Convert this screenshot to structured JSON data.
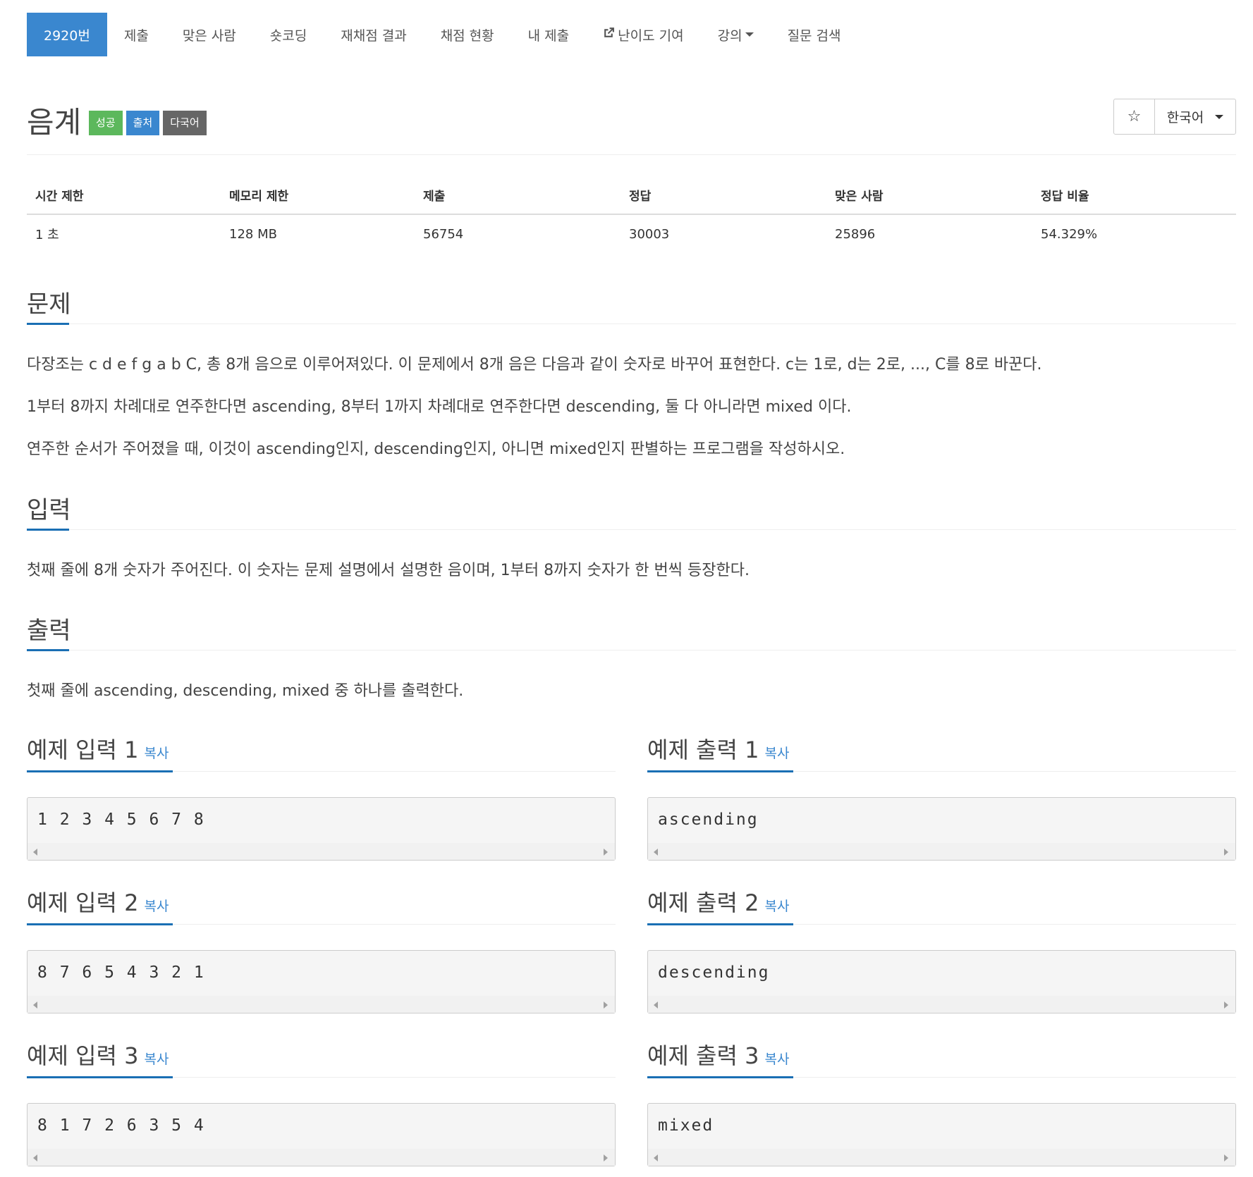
{
  "nav": {
    "items": [
      {
        "label": "2920번",
        "active": true
      },
      {
        "label": "제출"
      },
      {
        "label": "맞은 사람"
      },
      {
        "label": "숏코딩"
      },
      {
        "label": "재채점 결과"
      },
      {
        "label": "채점 현황"
      },
      {
        "label": "내 제출"
      },
      {
        "label": "난이도 기여",
        "icon": "external-link-icon"
      },
      {
        "label": "강의",
        "icon": "caret-down-icon"
      },
      {
        "label": "질문 검색"
      }
    ]
  },
  "problem": {
    "title": "음계",
    "badges": [
      {
        "label": "성공",
        "color": "#5cb85c"
      },
      {
        "label": "출처",
        "color": "#3a87cf"
      },
      {
        "label": "다국어",
        "color": "#666666"
      }
    ],
    "star_glyph": "☆",
    "language": "한국어"
  },
  "stats": {
    "headers": [
      "시간 제한",
      "메모리 제한",
      "제출",
      "정답",
      "맞은 사람",
      "정답 비율"
    ],
    "values": [
      "1 초",
      "128 MB",
      "56754",
      "30003",
      "25896",
      "54.329%"
    ]
  },
  "description": {
    "heading": "문제",
    "paragraphs": [
      "다장조는 c d e f g a b C, 총 8개 음으로 이루어져있다. 이 문제에서 8개 음은 다음과 같이 숫자로 바꾸어 표현한다. c는 1로, d는 2로, ..., C를 8로 바꾼다.",
      "1부터 8까지 차례대로 연주한다면 ascending, 8부터 1까지 차례대로 연주한다면 descending, 둘 다 아니라면 mixed 이다.",
      "연주한 순서가 주어졌을 때, 이것이 ascending인지, descending인지, 아니면 mixed인지 판별하는 프로그램을 작성하시오."
    ]
  },
  "input": {
    "heading": "입력",
    "text": "첫째 줄에 8개 숫자가 주어진다. 이 숫자는 문제 설명에서 설명한 음이며, 1부터 8까지 숫자가 한 번씩 등장한다."
  },
  "output": {
    "heading": "출력",
    "text": "첫째 줄에 ascending, descending, mixed 중 하나를 출력한다."
  },
  "samples": {
    "copy_label": "복사",
    "items": [
      {
        "in_title": "예제 입력 1",
        "in": "1 2 3 4 5 6 7 8",
        "out_title": "예제 출력 1",
        "out": "ascending"
      },
      {
        "in_title": "예제 입력 2",
        "in": "8 7 6 5 4 3 2 1",
        "out_title": "예제 출력 2",
        "out": "descending"
      },
      {
        "in_title": "예제 입력 3",
        "in": "8 1 7 2 6 3 5 4",
        "out_title": "예제 출력 3",
        "out": "mixed"
      }
    ]
  },
  "colors": {
    "accent": "#3a87cf",
    "underline": "#1a6fb4",
    "success": "#5cb85c"
  }
}
